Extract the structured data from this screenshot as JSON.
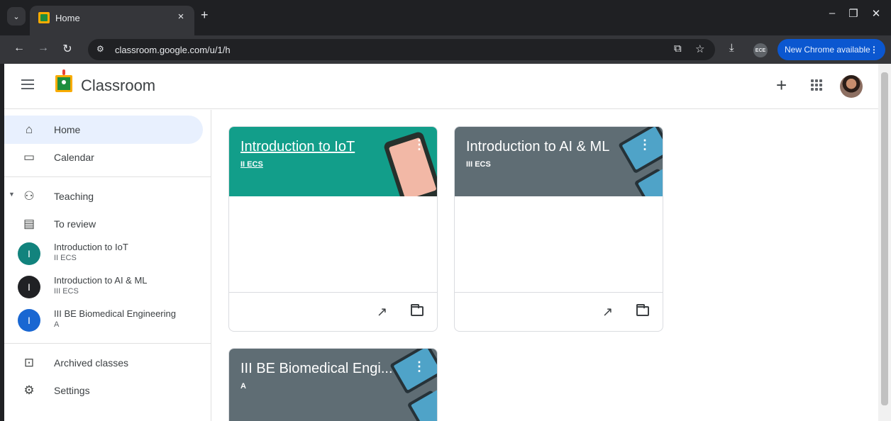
{
  "browser": {
    "tab_title": "Home",
    "tab_close": "×",
    "new_tab": "+",
    "url": "classroom.google.com/u/1/h",
    "profile_label": "ECE",
    "update_label": "New Chrome available"
  },
  "app": {
    "title": "Classroom"
  },
  "sidebar": {
    "home": "Home",
    "calendar": "Calendar",
    "teaching": "Teaching",
    "to_review": "To review",
    "classes": [
      {
        "initial": "I",
        "name": "Introduction to IoT",
        "section": "II ECS",
        "color": "#12837d"
      },
      {
        "initial": "I",
        "name": "Introduction to AI & ML",
        "section": "III ECS",
        "color": "#202124"
      },
      {
        "initial": "I",
        "name": "III BE Biomedical Engineering",
        "section": "A",
        "color": "#1967d2"
      }
    ],
    "archived": "Archived classes",
    "settings": "Settings"
  },
  "cards": [
    {
      "title": "Introduction to IoT",
      "section": "II ECS",
      "color": "#129e8a"
    },
    {
      "title": "Introduction to AI & ML",
      "section": "III ECS",
      "color": "#5f6d74"
    },
    {
      "title": "III BE Biomedical Engi...",
      "section": "A",
      "color": "#5f6d74"
    }
  ],
  "colors": {
    "accent": "#0b57d0",
    "active_nav": "#e8f0fe"
  }
}
